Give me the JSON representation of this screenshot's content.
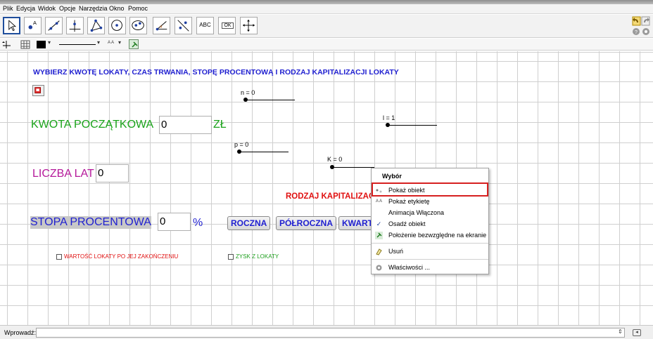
{
  "menu": [
    "Plik",
    "Edycja",
    "Widok",
    "Opcje",
    "Narzędzia",
    "Okno",
    "Pomoc"
  ],
  "toolbar": {
    "text_tool": "ABC",
    "ok_tool": "OK"
  },
  "canvas": {
    "instruction": "WYBIERZ KWOTĘ LOKATY, CZAS TRWANIA, STOPĘ PROCENTOWĄ I RODZAJ KAPITALIZACJI LOKATY",
    "kwota_label": "KWOTA POCZĄTKOWA",
    "kwota_value": "0",
    "kwota_unit": "ZŁ",
    "lata_label": "LICZBA LAT",
    "lata_value": "0",
    "stopa_label": "STOPA PROCENTOWA",
    "stopa_value": "0",
    "stopa_unit": "%",
    "kapitalizacja_label": "RODZAJ KAPITALIZAC",
    "buttons": [
      "ROCZNA",
      "PÓŁROCZNA",
      "KWART"
    ],
    "sliders": [
      {
        "label": "n = 0",
        "value": 0
      },
      {
        "label": "l = 1",
        "value": 1
      },
      {
        "label": "p = 0",
        "value": 0
      },
      {
        "label": "K = 0",
        "value": 0
      }
    ],
    "checkboxes": [
      {
        "label": "WARTOŚĆ LOKATY PO JEJ ZAKOŃCZENIU",
        "color": "#e01010",
        "checked": false
      },
      {
        "label": "ZYSK Z LOKATY",
        "color": "#20a020",
        "checked": false
      }
    ],
    "colors": {
      "kwota": "#1aa31a",
      "lata": "#b5199a",
      "stopa": "#1f1fd0",
      "kapitalizacja": "#e01010",
      "highlight_border": "#d62020"
    }
  },
  "context_menu": {
    "title": "Wybór",
    "items": [
      {
        "label": "Pokaż obiekt",
        "icon": "show-object-icon"
      },
      {
        "label": "Pokaż etykietę",
        "icon": "show-label-icon"
      },
      {
        "label": "Animacja Włączona",
        "icon": ""
      },
      {
        "label": "Osadź obiekt",
        "icon": "checkmark-icon"
      },
      {
        "label": "Położenie bezwzględne na ekranie",
        "icon": "pin-icon"
      },
      {
        "label": "Usuń",
        "icon": "eraser-icon"
      },
      {
        "label": "Właściwości ...",
        "icon": "gear-icon"
      }
    ]
  },
  "input_bar": {
    "label": "Wprowadź:",
    "value": ""
  }
}
